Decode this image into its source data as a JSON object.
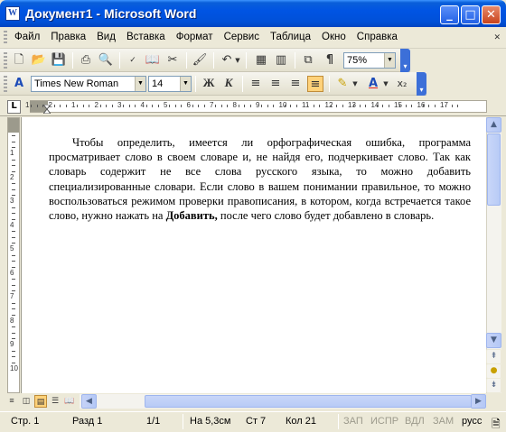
{
  "window": {
    "title": "Документ1 - Microsoft Word",
    "app_icon": "word-app-icon",
    "buttons": {
      "minimize": "_",
      "maximize": "□",
      "close": "✕"
    }
  },
  "menu": {
    "items": [
      "Файл",
      "Правка",
      "Вид",
      "Вставка",
      "Формат",
      "Сервис",
      "Таблица",
      "Окно",
      "Справка"
    ],
    "underline_letters": [
      "Ф",
      "П",
      "В",
      "а",
      "о",
      "С",
      "Т",
      "О",
      "С"
    ]
  },
  "standard_toolbar": {
    "zoom": "75%",
    "icons": [
      "new-icon",
      "open-icon",
      "save-icon",
      "print-icon",
      "print-preview-icon",
      "spelling-icon",
      "research-icon",
      "cut-icon",
      "format-painter-icon",
      "undo-icon",
      "insert-table-icon",
      "columns-icon",
      "drawing-icon",
      "show-formatting-icon"
    ]
  },
  "format_toolbar": {
    "font": "Times New Roman",
    "size": "14",
    "bold": "Ж",
    "italic": "К",
    "subscript": "x₂"
  },
  "ruler": {
    "tab_selector": "L",
    "h_numbers": [
      "1",
      "2",
      "1",
      "2",
      "3",
      "4",
      "5",
      "6",
      "7",
      "8",
      "9",
      "10",
      "11",
      "12",
      "13",
      "14",
      "15",
      "16",
      "17"
    ],
    "v_numbers": [
      "1",
      "2",
      "3",
      "4",
      "5",
      "6",
      "7",
      "8",
      "9",
      "10"
    ]
  },
  "document": {
    "paragraph_before_bold": "Чтобы определить, имеется ли орфографическая ошибка, программа просматривает слово в своем словаре и, не найдя его, подчеркивает слово. Так как словарь содержит не все слова русского языка, то можно добавить специализированные словари. Если слово в вашем понимании правильное, то можно воспользоваться режимом проверки правописания, в котором, когда встречается такое слово, нужно нажать на ",
    "bold_word": "Добавить,",
    "paragraph_after_bold": " после чего слово будет добавлено в словарь."
  },
  "statusbar": {
    "page": "Стр. 1",
    "section": "Разд 1",
    "pages": "1/1",
    "position": "На 5,3см",
    "line": "Ст 7",
    "column": "Кол 21",
    "rec": "ЗАП",
    "trk": "ИСПР",
    "ext": "ВДЛ",
    "ovr": "ЗАМ",
    "lang": "русс"
  }
}
